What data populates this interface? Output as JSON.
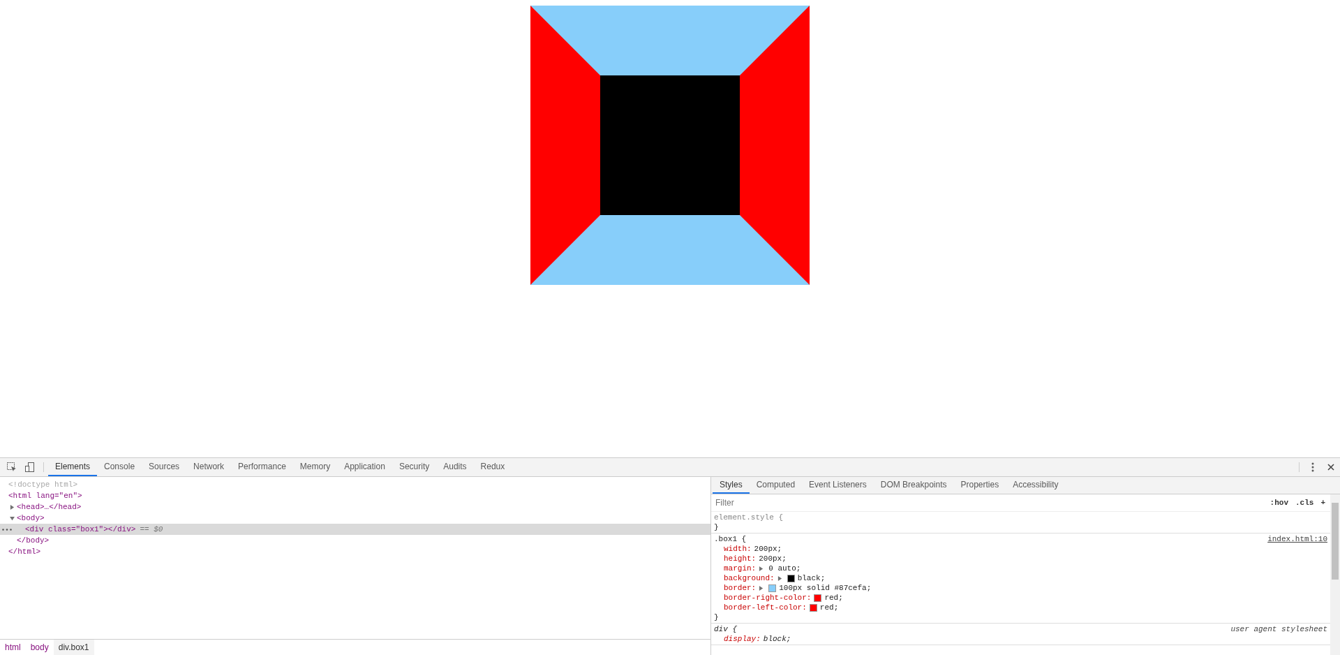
{
  "devtools": {
    "tabs": [
      {
        "label": "Elements",
        "selected": true
      },
      {
        "label": "Console",
        "selected": false
      },
      {
        "label": "Sources",
        "selected": false
      },
      {
        "label": "Network",
        "selected": false
      },
      {
        "label": "Performance",
        "selected": false
      },
      {
        "label": "Memory",
        "selected": false
      },
      {
        "label": "Application",
        "selected": false
      },
      {
        "label": "Security",
        "selected": false
      },
      {
        "label": "Audits",
        "selected": false
      },
      {
        "label": "Redux",
        "selected": false
      }
    ],
    "dom_tree": [
      {
        "kind": "doctype",
        "text": "<!doctype html>",
        "selected": false
      },
      {
        "kind": "element",
        "text": "<html lang=\"en\">",
        "closing": "</html>",
        "selected": false,
        "children": [
          {
            "kind": "element",
            "text": "<head>…</head>",
            "expanded": false,
            "selected": false
          },
          {
            "kind": "element",
            "text": "<body>",
            "closing": "</body>",
            "expanded": true,
            "selected": false,
            "children": [
              {
                "kind": "element",
                "text": "<div class=\"box1\"></div>",
                "marker": "== $0",
                "selected": true
              }
            ]
          }
        ]
      }
    ],
    "breadcrumbs": [
      {
        "label": "html",
        "selected": false
      },
      {
        "label": "body",
        "selected": false
      },
      {
        "label": "div.box1",
        "selected": true
      }
    ],
    "sidebar_tabs": [
      {
        "label": "Styles",
        "selected": true
      },
      {
        "label": "Computed",
        "selected": false
      },
      {
        "label": "Event Listeners",
        "selected": false
      },
      {
        "label": "DOM Breakpoints",
        "selected": false
      },
      {
        "label": "Properties",
        "selected": false
      },
      {
        "label": "Accessibility",
        "selected": false
      }
    ],
    "filter": {
      "placeholder": "Filter"
    },
    "filter_buttons": [
      ":hov",
      ".cls",
      "+"
    ],
    "rules": [
      {
        "kind": "inline",
        "selector": "element.style {",
        "closing": "}"
      },
      {
        "kind": "author",
        "selector": ".box1 {",
        "source": "index.html:10",
        "closing": "}",
        "properties": [
          {
            "name": "width:",
            "value": "200px;",
            "expandable": false
          },
          {
            "name": "height:",
            "value": "200px;",
            "expandable": false
          },
          {
            "name": "margin:",
            "value": "0 auto;",
            "expandable": true
          },
          {
            "name": "background:",
            "value": "black;",
            "expandable": true,
            "color": "#000000"
          },
          {
            "name": "border:",
            "value": "100px solid #87cefa;",
            "expandable": true,
            "color": "#87cefa"
          },
          {
            "name": "border-right-color:",
            "value": "red;",
            "expandable": false,
            "color": "#ff0000"
          },
          {
            "name": "border-left-color:",
            "value": "red;",
            "expandable": false,
            "color": "#ff0000"
          }
        ]
      },
      {
        "kind": "user-agent",
        "selector": "div {",
        "source": "user agent stylesheet",
        "properties": [
          {
            "name": "display:",
            "value": "block;"
          }
        ]
      }
    ]
  }
}
